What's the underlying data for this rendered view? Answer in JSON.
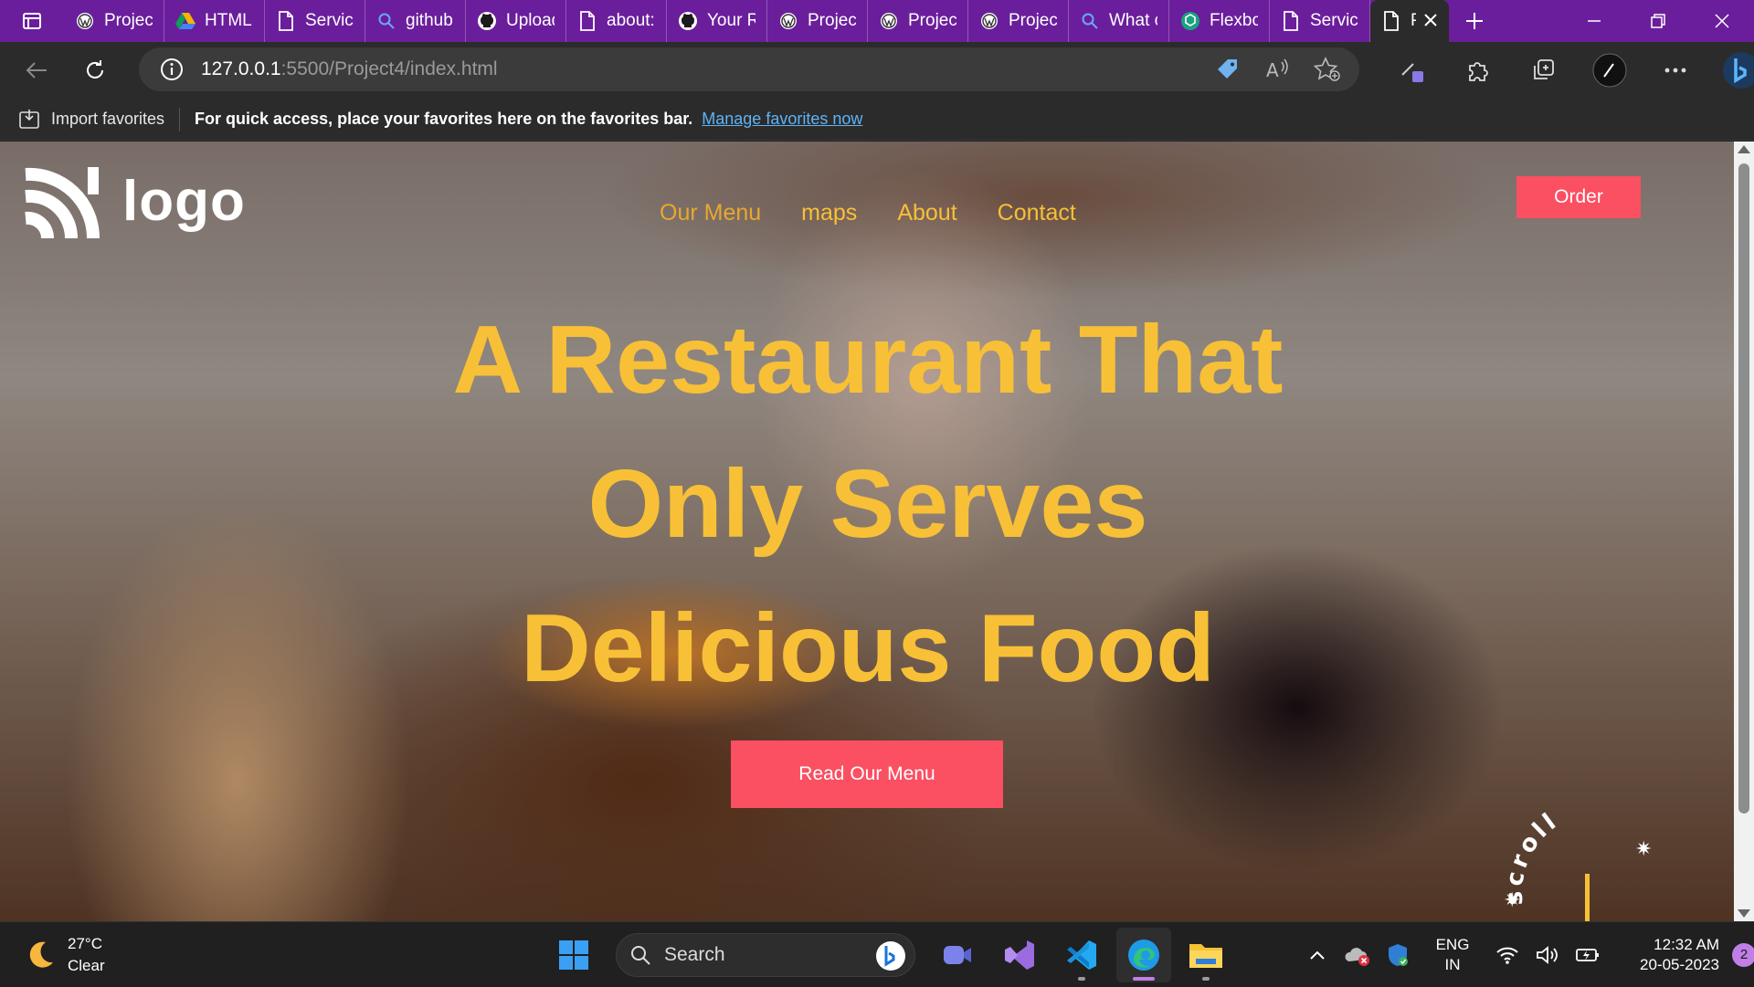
{
  "browser": {
    "tabs": [
      {
        "label": "Project",
        "icon": "wordpress-icon"
      },
      {
        "label": "HTML",
        "icon": "google-drive-icon"
      },
      {
        "label": "Service",
        "icon": "page-icon"
      },
      {
        "label": "github",
        "icon": "search-icon"
      },
      {
        "label": "Upload",
        "icon": "github-icon"
      },
      {
        "label": "about:",
        "icon": "page-icon"
      },
      {
        "label": "Your R",
        "icon": "github-icon"
      },
      {
        "label": "Project",
        "icon": "wordpress-icon"
      },
      {
        "label": "Project",
        "icon": "wordpress-icon"
      },
      {
        "label": "Project",
        "icon": "wordpress-icon"
      },
      {
        "label": "What c",
        "icon": "search-icon"
      },
      {
        "label": "Flexbo",
        "icon": "chatgpt-icon"
      },
      {
        "label": "Service",
        "icon": "page-icon"
      }
    ],
    "active_tab": {
      "label": "Pr",
      "icon": "page-icon"
    },
    "url_host": "127.0.0.1",
    "url_rest": ":5500/Project4/index.html",
    "favorites": {
      "import_label": "Import favorites",
      "message": "For quick access, place your favorites here on the favorites bar.",
      "link": "Manage favorites now"
    }
  },
  "site": {
    "logo_text": "logo",
    "nav": [
      "Our Menu",
      "maps",
      "About",
      "Contact"
    ],
    "order_label": "Order",
    "hero_lines": [
      "A Restaurant That",
      "Only Serves",
      "Delicious Food"
    ],
    "cta_label": "Read Our Menu",
    "scroll_label": "scroll"
  },
  "taskbar": {
    "weather_temp": "27°C",
    "weather_desc": "Clear",
    "search_placeholder": "Search",
    "lang_line1": "ENG",
    "lang_line2": "IN",
    "time": "12:32 AM",
    "date": "20-05-2023",
    "notification_count": "2"
  },
  "colors": {
    "tabstrip": "#6b1e9c",
    "accent_yellow": "#f8c036",
    "button_red": "#fb4f62"
  }
}
